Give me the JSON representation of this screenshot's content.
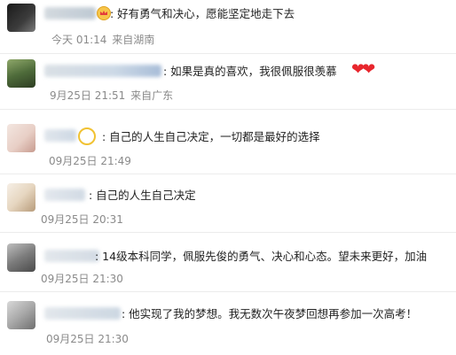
{
  "comments": [
    {
      "text": ":  好有勇气和决心，愿能坚定地走下去",
      "time": "今天 01:14",
      "location": "来自湖南",
      "badge": "crown-badge"
    },
    {
      "text": ":  如果是真的喜欢，我很佩服很羡慕",
      "emoji": "❤❤",
      "time": "9月25日 21:51",
      "location": "来自广东"
    },
    {
      "text": ":  自己的人生自己决定，一切都是最好的选择",
      "time": "09月25日 21:49",
      "badge": "moon-badge"
    },
    {
      "text": ":  自己的人生自己决定",
      "time": "09月25日 20:31"
    },
    {
      "text": ":  14级本科同学，佩服先俊的勇气、决心和心态。望未来更好，加油",
      "time": "09月25日 21:30"
    },
    {
      "text": ":  他实现了我的梦想。我无数次午夜梦回想再参加一次高考！",
      "time": "09月25日 21:30"
    }
  ],
  "colors": {
    "meta": "#8a8a8a",
    "heart": "#e8262d",
    "divider": "#ececec"
  }
}
